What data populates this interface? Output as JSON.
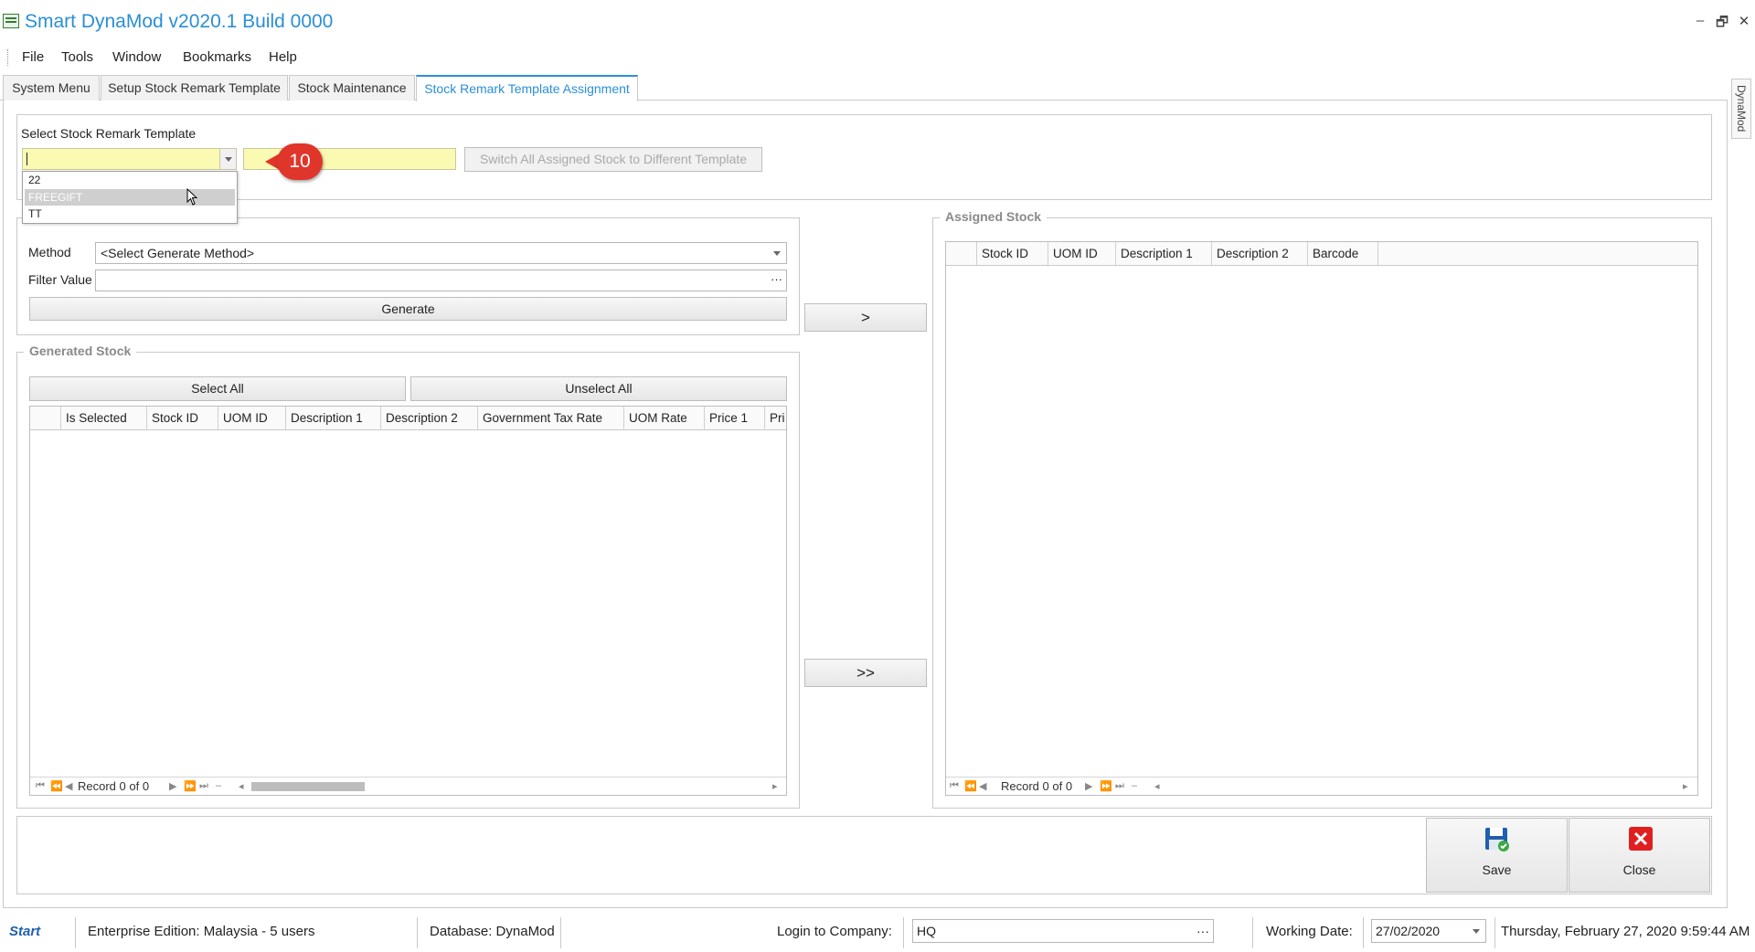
{
  "window": {
    "title": "Smart DynaMod v2020.1 Build 0000",
    "controls": {
      "minimize": "–",
      "restore": "🗗",
      "close": "✕"
    }
  },
  "menu": [
    "File",
    "Tools",
    "Window",
    "Bookmarks",
    "Help"
  ],
  "tabs": [
    {
      "label": "System Menu",
      "active": false
    },
    {
      "label": "Setup Stock Remark Template",
      "active": false
    },
    {
      "label": "Stock Maintenance",
      "active": false
    },
    {
      "label": "Stock Remark Template Assignment",
      "active": true
    }
  ],
  "dock_tab": "DynaMod",
  "template_section": {
    "label": "Select Stock Remark Template",
    "combo_value": "",
    "description_value": "",
    "switch_button": "Switch All Assigned Stock to Different Template",
    "dropdown_items": [
      "22",
      "FREEGIFT",
      "TT"
    ],
    "dropdown_highlighted": "FREEGIFT"
  },
  "callout_badge": "10",
  "generate_section": {
    "method_label": "Method",
    "method_value": "<Select Generate Method>",
    "filter_label": "Filter Value",
    "filter_value": "",
    "filter_ellipsis": "···",
    "generate_button": "Generate"
  },
  "generated_stock": {
    "title": "Generated Stock",
    "select_all": "Select All",
    "unselect_all": "Unselect All",
    "columns": [
      "",
      "Is Selected",
      "Stock ID",
      "UOM ID",
      "Description 1",
      "Description 2",
      "Government Tax Rate",
      "UOM Rate",
      "Price 1",
      "Pri"
    ],
    "record_text": "Record 0 of 0"
  },
  "transfer_buttons": {
    "single": ">",
    "all": ">>"
  },
  "assigned_stock": {
    "title": "Assigned Stock",
    "columns": [
      "",
      "Stock ID",
      "UOM ID",
      "Description 1",
      "Description 2",
      "Barcode"
    ],
    "record_text": "Record 0 of 0"
  },
  "actions": {
    "save": "Save",
    "close": "Close"
  },
  "statusbar": {
    "logo": "Start",
    "edition": "Enterprise Edition: Malaysia - 5 users",
    "database": "Database: DynaMod",
    "login_label": "Login to Company:",
    "login_value": "HQ",
    "login_ellipsis": "···",
    "working_date_label": "Working Date:",
    "working_date_value": "27/02/2020",
    "datetime": "Thursday, February 27, 2020 9:59:44 AM"
  },
  "colors": {
    "accent": "#2a8fd6",
    "highlight_input": "#fbfab2",
    "badge": "#e0352b"
  }
}
